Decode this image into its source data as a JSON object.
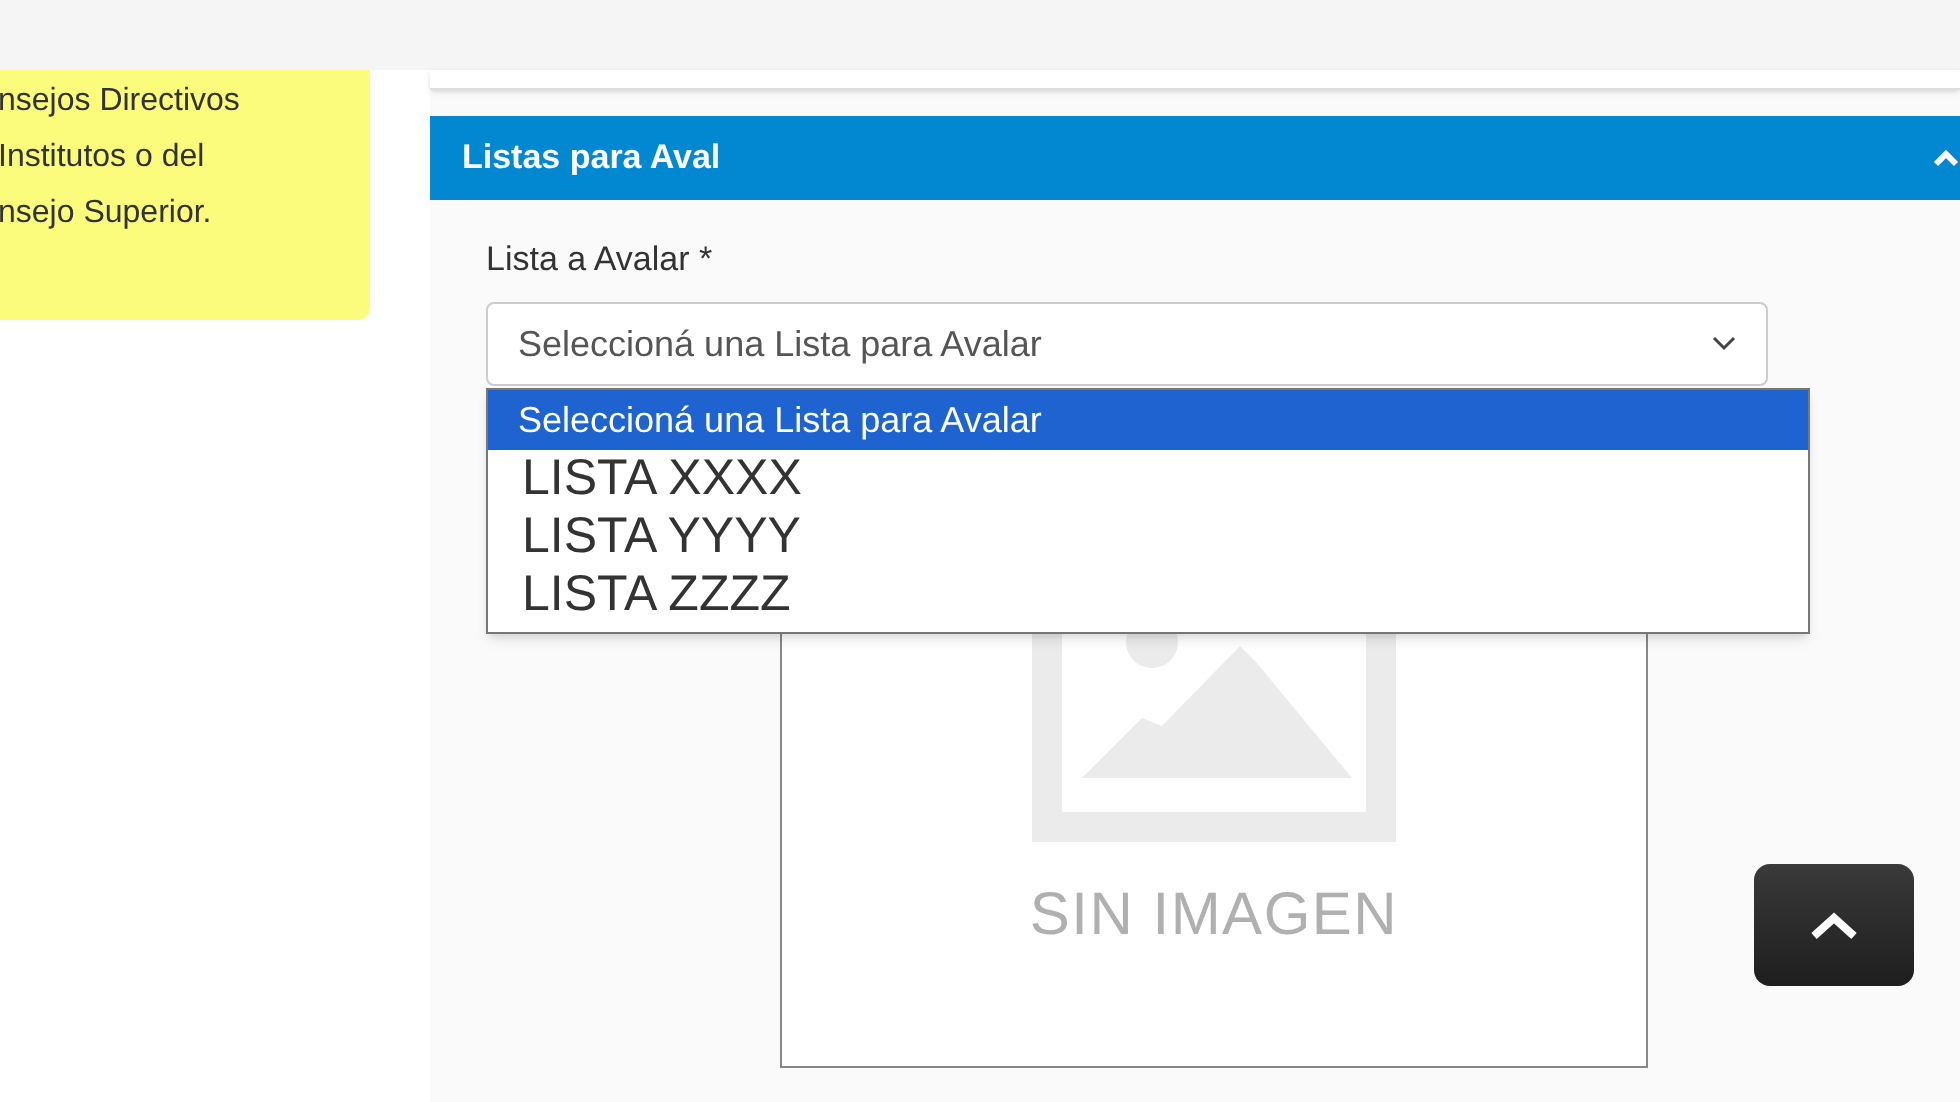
{
  "note": {
    "lines": [
      "nsejos Directivos",
      "Institutos o del",
      "nsejo Superior."
    ]
  },
  "panel": {
    "title": "Listas para Aval",
    "expanded": true,
    "field": {
      "label": "Lista a Avalar *",
      "value": "Seleccioná una Lista para Avalar",
      "options": [
        {
          "label": "Seleccioná una Lista para Avalar",
          "selected": true
        },
        {
          "label": "LISTA XXXX",
          "selected": false
        },
        {
          "label": "LISTA YYYY",
          "selected": false
        },
        {
          "label": "LISTA ZZZZ",
          "selected": false
        }
      ]
    },
    "image": {
      "caption": "SIN IMAGEN"
    }
  }
}
